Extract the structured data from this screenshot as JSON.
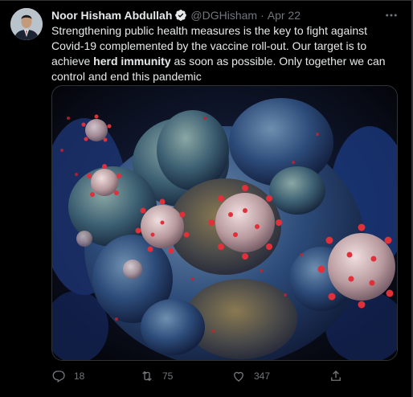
{
  "tweet": {
    "author": {
      "display_name": "Noor Hisham Abdullah",
      "handle": "@DGHisham",
      "verified": true
    },
    "separator": "·",
    "date": "Apr 22",
    "text_parts": [
      "Strengthening public health measures is the key to fight against Covid-19 complemented  by the vaccine roll-out. Our target is to achieve ",
      "herd immunity",
      " as soon as possible. Only together we can control and end this pandemic"
    ],
    "media": {
      "icon": "virus-image"
    },
    "stats": {
      "replies": "18",
      "retweets": "75",
      "likes": "347"
    }
  },
  "colors": {
    "background": "#000000",
    "text": "#e7e9ea",
    "muted": "#71767b",
    "border": "#2f3336",
    "verified": "#1d9bf0"
  }
}
